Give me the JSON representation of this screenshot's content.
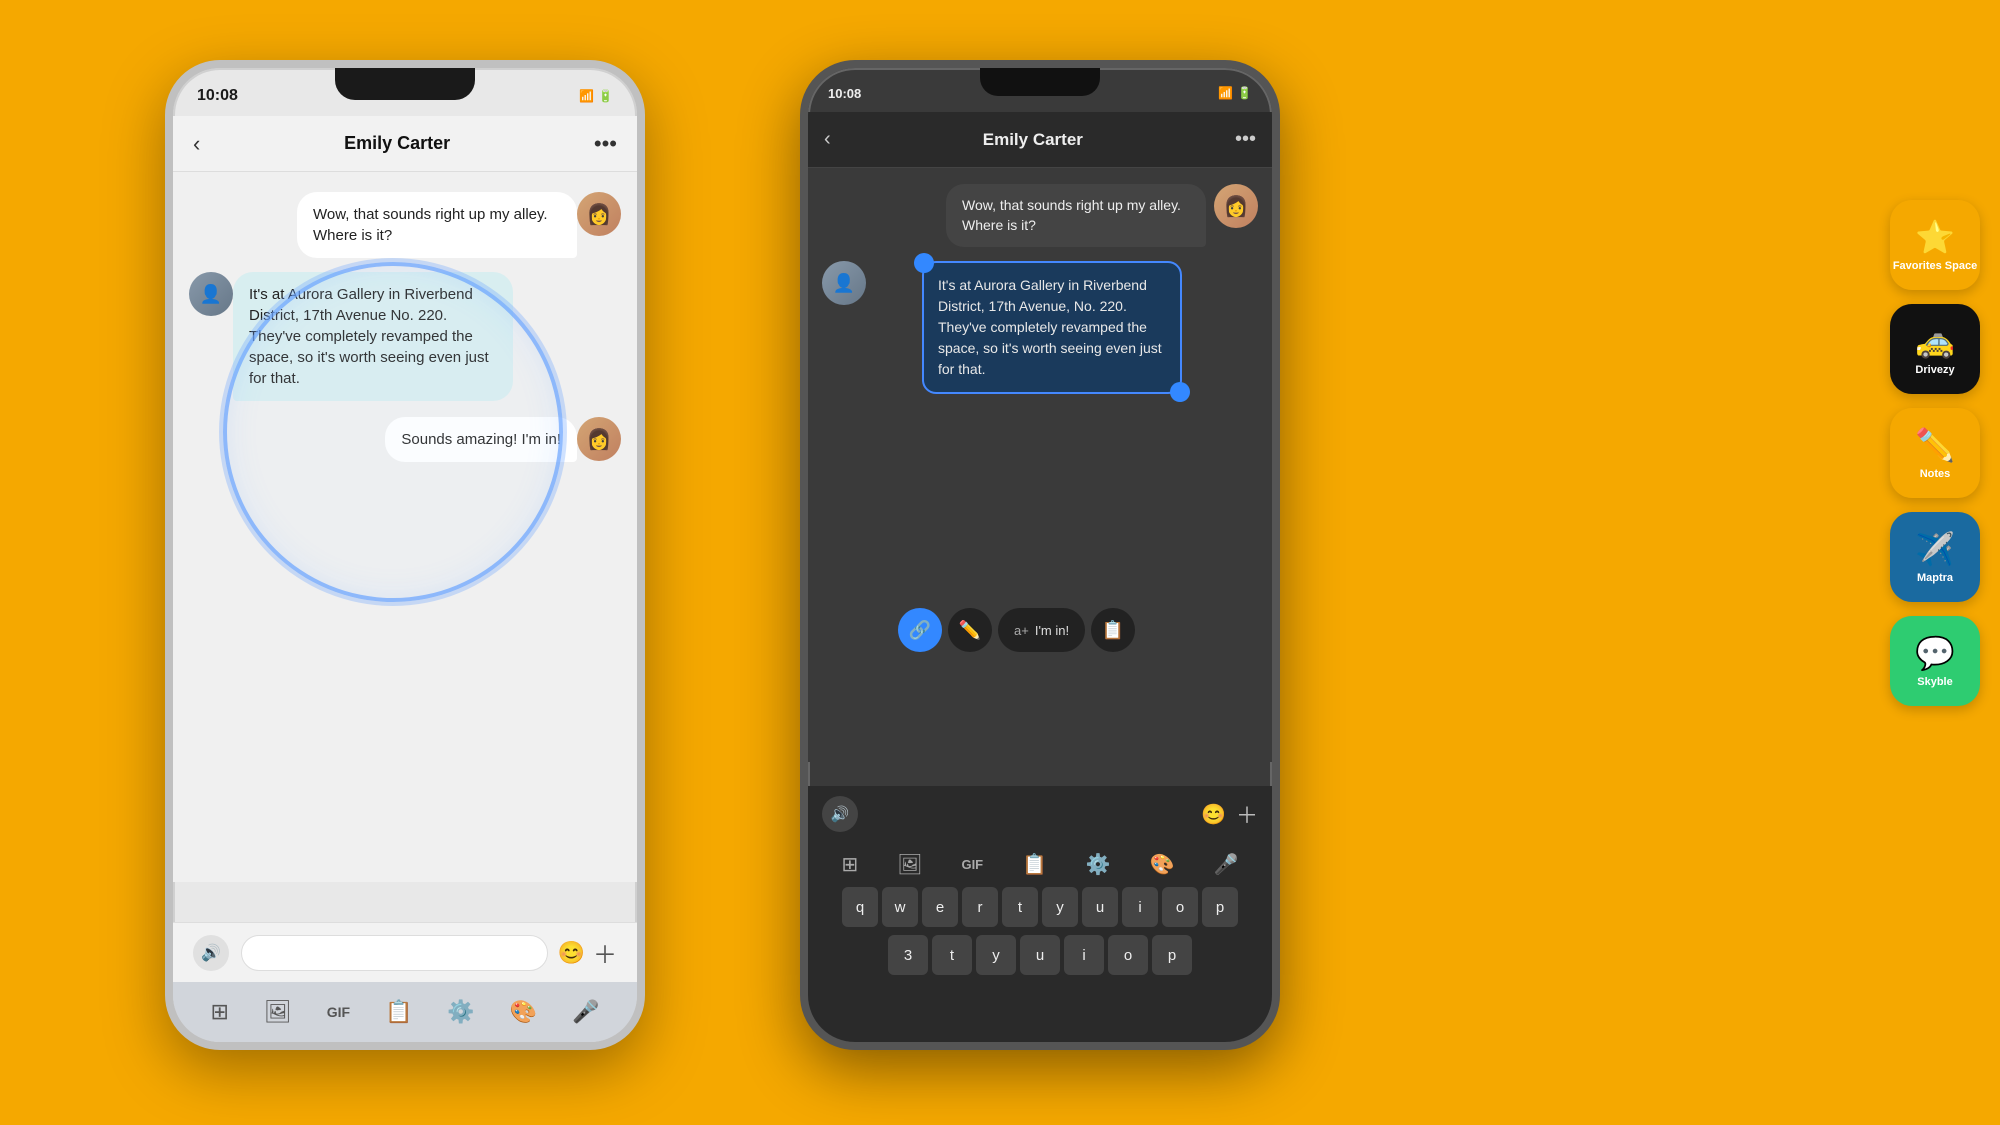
{
  "background": "#F5A800",
  "phoneLeft": {
    "statusBar": {
      "time": "10:08",
      "icons": "📶 🔋"
    },
    "header": {
      "contactName": "Emily Carter",
      "backLabel": "‹",
      "moreLabel": "•••"
    },
    "messages": [
      {
        "id": "msg1",
        "type": "outgoing",
        "text": "Wow, that sounds right up my alley. Where is it?",
        "avatar": "👩"
      },
      {
        "id": "msg2",
        "type": "incoming",
        "text": "It's at Aurora Gallery in Riverbend District, 17th Avenue No. 220. They've completely revamped the space, so it's worth seeing even just for that.",
        "avatar": "👤"
      },
      {
        "id": "msg3",
        "type": "outgoing",
        "text": "Sounds amazing! I'm in!",
        "avatar": "👩"
      }
    ]
  },
  "phoneRight": {
    "statusBar": {
      "time": "10:08",
      "icons": "📶 🔋"
    },
    "header": {
      "contactName": "Emily Carter",
      "backLabel": "‹",
      "moreLabel": "•••"
    },
    "messages": [
      {
        "id": "msg1",
        "type": "outgoing",
        "text": "Wow, that sounds right up my alley. Where is it?",
        "avatar": "👩"
      },
      {
        "id": "msg2-selected",
        "type": "incoming",
        "text": "It's at Aurora Gallery in Riverbend District, 17th Avenue, No. 220. They've completely revamped the space, so it's worth seeing even just for that.",
        "avatar": "👤",
        "selected": true
      }
    ],
    "contextMenu": {
      "btn1": "🔗",
      "btn2": "✏️",
      "replyText": "a+",
      "btn3": "📋"
    }
  },
  "sideApps": [
    {
      "id": "favorites",
      "label": "Favorites Space",
      "icon": "⭐",
      "color": "#F5A800"
    },
    {
      "id": "taxi",
      "label": "Drivezy",
      "icon": "🚕",
      "color": "#111111"
    },
    {
      "id": "notes",
      "label": "Notes",
      "icon": "✏️",
      "color": "#F5A800"
    },
    {
      "id": "maptra",
      "label": "Maptra",
      "icon": "✈️",
      "color": "#1a6aa0"
    },
    {
      "id": "skyble",
      "label": "Skyble",
      "icon": "💬",
      "color": "#2ecc71"
    }
  ],
  "keyboard": {
    "keys": [
      "q",
      "w",
      "e",
      "r",
      "t",
      "y",
      "u",
      "i",
      "o",
      "p"
    ]
  }
}
